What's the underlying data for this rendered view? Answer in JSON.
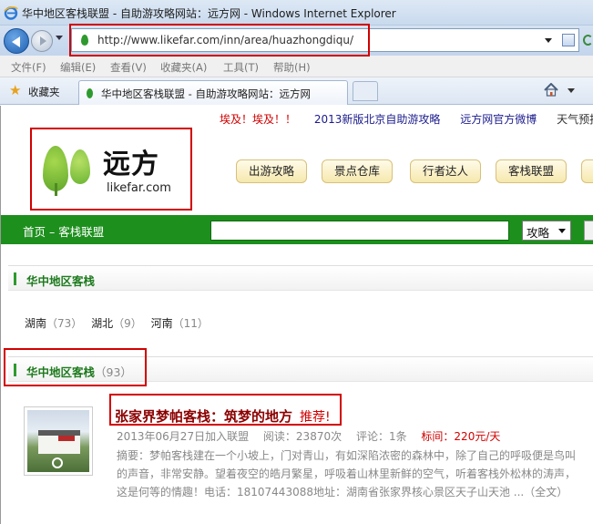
{
  "window": {
    "title": "华中地区客栈联盟 - 自助游攻略网站：远方网 - Windows Internet Explorer"
  },
  "addressbar": {
    "url": "http://www.likefar.com/inn/area/huazhongdiqu/"
  },
  "menubar": {
    "items": [
      "文件(F)",
      "编辑(E)",
      "查看(V)",
      "收藏夹(A)",
      "工具(T)",
      "帮助(H)"
    ]
  },
  "favbar": {
    "favorites_label": "收藏夹",
    "tab_title": "华中地区客栈联盟 - 自助游攻略网站：远方网"
  },
  "page": {
    "ticker": {
      "hot": "埃及！埃及！！",
      "items": [
        "2013新版北京自助游攻略",
        "远方网官方微博",
        "天气预报"
      ]
    },
    "logo": {
      "brand": "远方",
      "domain": "likefar.com"
    },
    "nav": [
      "出游攻略",
      "景点仓库",
      "行者达人",
      "客栈联盟"
    ],
    "breadcrumb": "首页 – 客栈联盟",
    "search": {
      "value": "",
      "select_value": "攻略"
    },
    "section1": {
      "title": "华中地区客栈"
    },
    "regions": [
      {
        "name": "湖南",
        "count": "（73）"
      },
      {
        "name": "湖北",
        "count": "（9）"
      },
      {
        "name": "河南",
        "count": "（11）"
      }
    ],
    "section2": {
      "title": "华中地区客栈",
      "count": "（93）"
    },
    "entry": {
      "title": "张家界梦帕客栈：筑梦的地方",
      "badge": "推荐!",
      "date": "2013年06月27日加入联盟",
      "views": "阅读：23870次",
      "comments": "评论：1条",
      "price_label": "标间：",
      "price": "220元/天",
      "summary": "摘要：梦帕客栈建在一个小坡上，门对青山，有如深陷浓密的森林中，除了自己的呼吸便是鸟叫的声音，非常安静。望着夜空的皓月繁星，呼吸着山林里新鲜的空气，听着客栈外松林的涛声，这是何等的情趣！电话：18107443088地址：湖南省张家界核心景区天子山天池 ...（全文）"
    }
  }
}
